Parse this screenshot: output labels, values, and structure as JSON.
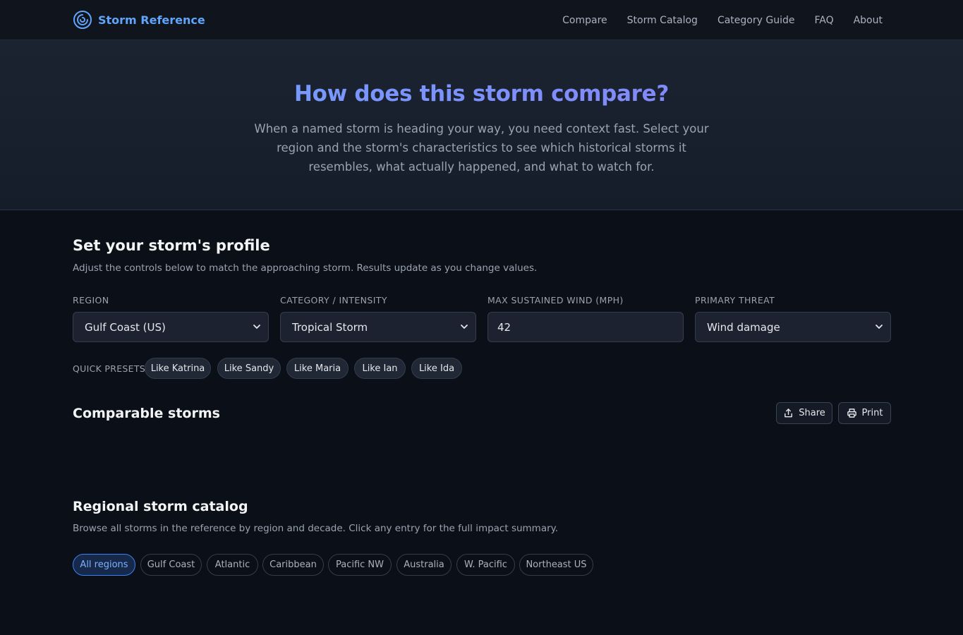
{
  "header": {
    "brand": "Storm Reference",
    "nav": [
      "Compare",
      "Storm Catalog",
      "Category Guide",
      "FAQ",
      "About"
    ]
  },
  "hero": {
    "title": "How does this storm compare?",
    "subtitle": "When a named storm is heading your way, you need context fast. Select your region and the storm's characteristics to see which historical storms it resembles, what actually happened, and what to watch for."
  },
  "profile": {
    "title": "Set your storm's profile",
    "subtitle": "Adjust the controls below to match the approaching storm. Results update as you change values.",
    "fields": {
      "region": {
        "label": "REGION",
        "value": "Gulf Coast (US)"
      },
      "category": {
        "label": "CATEGORY / INTENSITY",
        "value": "Tropical Storm"
      },
      "wind": {
        "label": "MAX SUSTAINED WIND (MPH)",
        "value": "42"
      },
      "threat": {
        "label": "PRIMARY THREAT",
        "value": "Wind damage"
      }
    },
    "presets_label": "QUICK PRESETS:",
    "presets": [
      "Like Katrina",
      "Like Sandy",
      "Like Maria",
      "Like Ian",
      "Like Ida"
    ]
  },
  "comparable": {
    "title": "Comparable storms",
    "share_label": "Share",
    "print_label": "Print"
  },
  "catalog": {
    "title": "Regional storm catalog",
    "subtitle": "Browse all storms in the reference by region and decade. Click any entry for the full impact summary.",
    "regions": [
      "All regions",
      "Gulf Coast",
      "Atlantic",
      "Caribbean",
      "Pacific NW",
      "Australia",
      "W. Pacific",
      "Northeast US"
    ],
    "active_region": "All regions"
  },
  "colors": {
    "accent": "#3b82f6",
    "brand": "#60a5fa",
    "background": "#0b0f17"
  }
}
